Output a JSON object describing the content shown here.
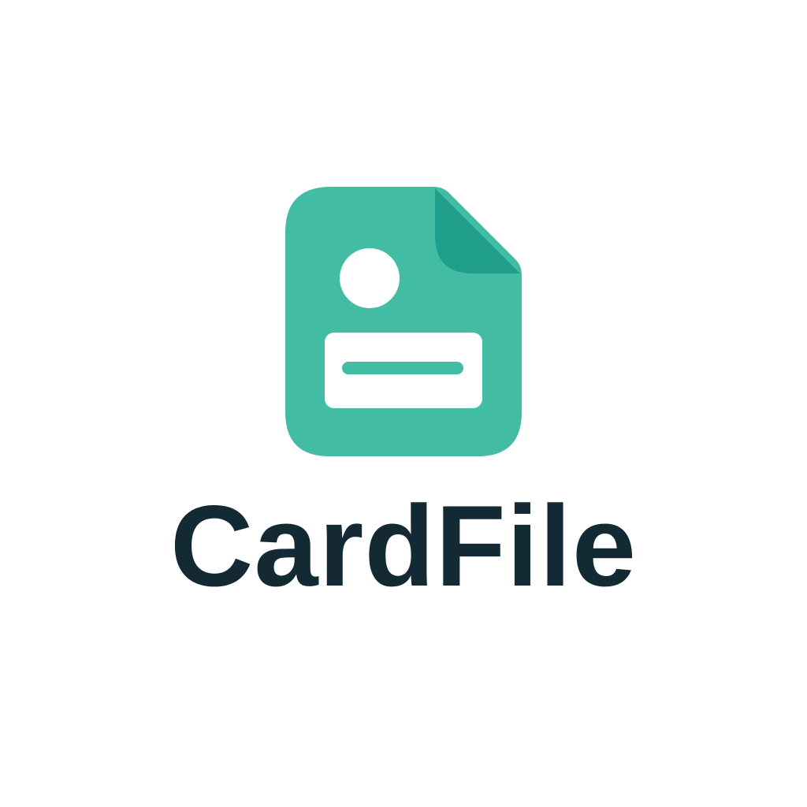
{
  "brand": {
    "name": "CardFile"
  },
  "icon": {
    "name": "document-card-icon"
  },
  "colors": {
    "background": "#ffffff",
    "icon_body": "#43bca4",
    "icon_fold": "#1f9f8a",
    "icon_detail": "#ffffff",
    "wordmark": "#132a35"
  }
}
